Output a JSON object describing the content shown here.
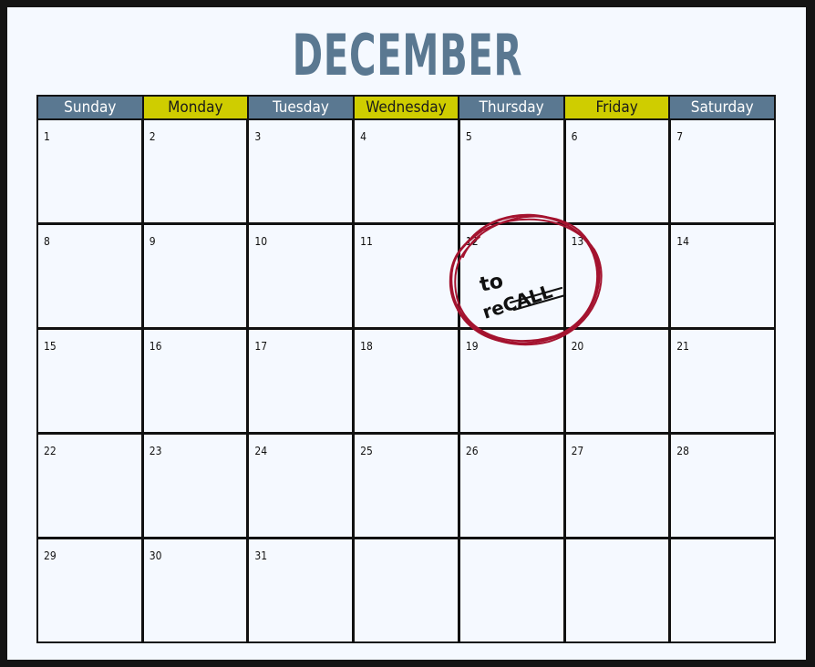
{
  "calendar": {
    "month": "DECEMBER",
    "weekdays": [
      "Sunday",
      "Monday",
      "Tuesday",
      "Wednesday",
      "Thursday",
      "Friday",
      "Saturday"
    ],
    "dates": [
      "1",
      "2",
      "3",
      "4",
      "5",
      "6",
      "7",
      "8",
      "9",
      "10",
      "11",
      "12",
      "13",
      "14",
      "15",
      "16",
      "17",
      "18",
      "19",
      "20",
      "21",
      "22",
      "23",
      "24",
      "25",
      "26",
      "27",
      "28",
      "29",
      "30",
      "31",
      "",
      "",
      "",
      ""
    ],
    "colors": {
      "header_primary": "#5a7891",
      "header_accent": "#cfcd00",
      "annotation_circle": "#a4132f"
    },
    "annotation": {
      "day": "12",
      "line1": "to",
      "line2": "reCALL"
    }
  }
}
